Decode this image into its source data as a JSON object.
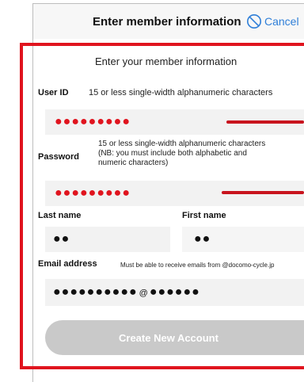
{
  "header": {
    "title": "Enter member information",
    "cancel_label": "Cancel",
    "cancel_icon": "cancel-circle-icon",
    "cancel_color": "#2f7fd8"
  },
  "form": {
    "heading": "Enter your member information",
    "user_id": {
      "label": "User ID",
      "hint": "15 or less single-width alphanumeric characters",
      "value": "●●●●●●●●●"
    },
    "password": {
      "label": "Password",
      "hint": "15 or less single-width alphanumeric characters (NB: you must include both alphabetic and numeric characters)",
      "value": "●●●●●●●●●"
    },
    "last_name": {
      "label": "Last name",
      "value": "●●"
    },
    "first_name": {
      "label": "First name",
      "value": "●●"
    },
    "email": {
      "label": "Email address",
      "hint": "Must be able to receive emails from @docomo-cycle.jp",
      "local_part": "●●●●●●●●●●",
      "at_sign": "@",
      "domain_part": "●●●●●●"
    },
    "create_button_label": "Create New Account"
  },
  "colors": {
    "highlight": "#e0141e",
    "masked_value": "#e0141e",
    "button_disabled": "#c9c9c9"
  }
}
